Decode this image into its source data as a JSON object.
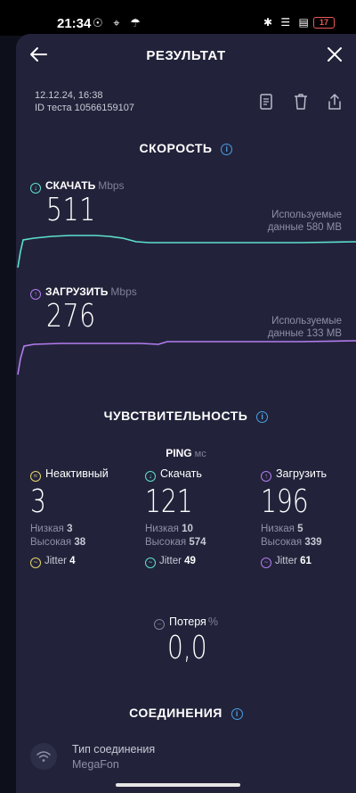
{
  "statusbar": {
    "time": "21:34",
    "left_icons": "☉ ⌖ ☂",
    "right_icons": "✱ ☰ ▤",
    "battery": "17"
  },
  "header": {
    "title": "РЕЗУЛЬТАТ"
  },
  "test": {
    "date": "12.12.24, 16:38",
    "id": "ID теста 10566159107"
  },
  "speed": {
    "title": "СКОРОСТЬ",
    "download": {
      "label": "СКАЧАТЬ",
      "unit": "Mbps",
      "value": "511",
      "used_line1": "Используемые",
      "used_line2": "данные 580 MB"
    },
    "upload": {
      "label": "ЗАГРУЗИТЬ",
      "unit": "Mbps",
      "value": "276",
      "used_line1": "Используемые",
      "used_line2": "данные 133 MB"
    }
  },
  "sensitivity": {
    "title": "ЧУВСТВИТЕЛЬНОСТЬ",
    "ping_label": "PING",
    "ping_unit": "мс",
    "columns": [
      {
        "label": "Неактивный",
        "value": "3",
        "low_label": "Низкая",
        "low": "3",
        "high_label": "Высокая",
        "high": "38",
        "jitter_label": "Jitter",
        "jitter": "4"
      },
      {
        "label": "Скачать",
        "value": "121",
        "low_label": "Низкая",
        "low": "10",
        "high_label": "Высокая",
        "high": "574",
        "jitter_label": "Jitter",
        "jitter": "49"
      },
      {
        "label": "Загрузить",
        "value": "196",
        "low_label": "Низкая",
        "low": "5",
        "high_label": "Высокая",
        "high": "339",
        "jitter_label": "Jitter",
        "jitter": "61"
      }
    ],
    "loss_label": "Потеря",
    "loss_unit": "%",
    "loss_value": "0,0"
  },
  "connections": {
    "title": "СОЕДИНЕНИЯ",
    "type_label": "Тип соединения",
    "type_value": "MegaFon"
  },
  "colors": {
    "download": "#5ee0d0",
    "upload": "#b57cf0",
    "idle": "#e8d56a",
    "info": "#4aa0e6",
    "sheet": "#22233a"
  },
  "icons": [
    "back-arrow-icon",
    "close-icon",
    "document-icon",
    "trash-icon",
    "share-icon",
    "info-icon",
    "download-icon",
    "upload-icon",
    "idle-icon",
    "jitter-icon",
    "loss-icon",
    "wifi-icon"
  ]
}
